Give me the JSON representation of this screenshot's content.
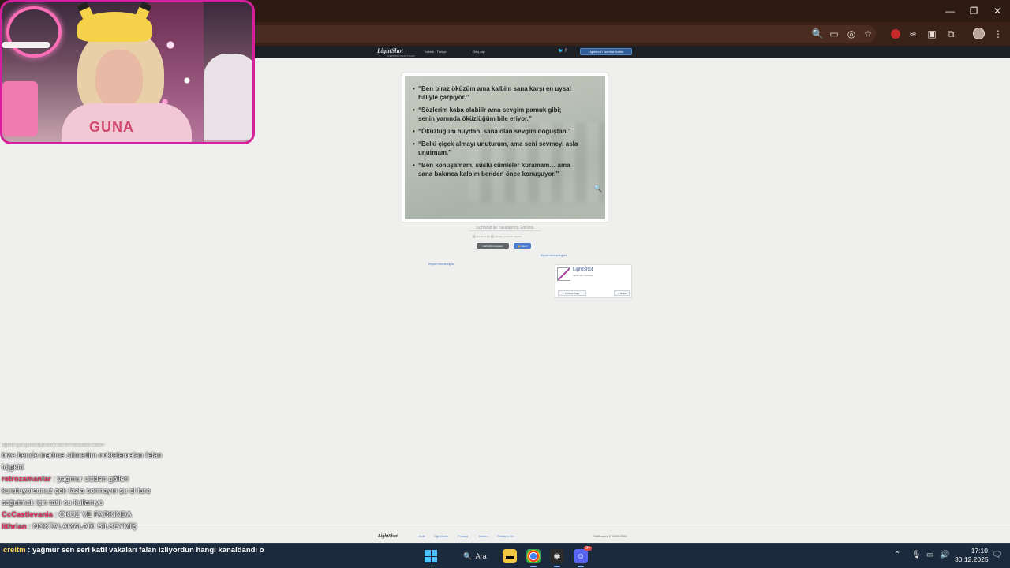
{
  "browser": {
    "window_controls": {
      "minimize": "—",
      "maximize": "❐",
      "close": "✕"
    }
  },
  "site": {
    "logo": "LightShot",
    "logo_sub": "SCREENSHOT SOFTWARE",
    "language": "Turkish - Türkçe",
    "login": "Giriş yap",
    "social": "🐦 f",
    "download_button": "Lightshot'ı ücretsiz indirin"
  },
  "screenshot": {
    "quotes": [
      "“Ben biraz öküzüm ama kalbim sana karşı en uysal haliyle çarpıyor.”",
      "“Sözlerim kaba olabilir ama sevgim pamuk gibi; senin yanında öküzlüğüm bile eriyor.”",
      "“Öküzlüğüm huydan, sana olan sevgim doğuştan.”",
      "“Belki çiçek almayı unuturum, ama seni sevmeyi asla unutmam.”",
      "“Ben konuşamam, süslü cümleler kuramam… ama sana bakınca kalbim benden önce konuşuyor.”"
    ],
    "caption": "Lightshot ile Yakalanmış Görüntü",
    "small_links": "🖼 Benzerini bul   🖼 Görsele yorumunu kaydet",
    "share_button": "Görüntüyü paylaşın",
    "like_button": "👍 Like 0",
    "report_left": "Report misleading ad",
    "report_right": "Report misleading ad"
  },
  "facebook_box": {
    "name": "LightShot",
    "subtitle": "Skillbrains Software",
    "follow": "Follow Page",
    "share": "Share"
  },
  "footer": {
    "logo": "LightShot",
    "links": [
      "İndir",
      "Öğreticiler",
      "Privacy",
      "Yardım",
      "Reklamı Ver"
    ],
    "copyright": "Skillbrains © 2009-2022"
  },
  "chat": {
    "faded": "oğmur gibi görünüyo biraz da sırf karşıdaki adam",
    "lines": [
      {
        "user": "",
        "text": "bize bende inadına silmedim noktalamaları falan fdjgkfd"
      },
      {
        "user": "retrozamanlar",
        "text": "yağmur cidden gölleri kurutuyorsunuz çok fazla sormayın şu ol fara soğutmak için tatlı su kullanıyo"
      },
      {
        "user": "CcCastlevania",
        "text": "ÖKÜZ VE FARKINDA"
      },
      {
        "user": "lithrian",
        "text": "NOKTALAMALARI SİLSEYMİŞ"
      }
    ],
    "taskbar_line_user": "creitm",
    "taskbar_line_text": "yağmur sen seri katil vakaları falan izliyordun hangi kanaldandı o"
  },
  "taskbar": {
    "search_label": "Ara",
    "discord_badge": "9+",
    "time": "17:10",
    "date": "30.12.2025"
  },
  "icons": [
    "zoom-icon",
    "cast-icon",
    "eye-off-icon",
    "star-icon",
    "extensions-icon",
    "profile-avatar",
    "menu-icon",
    "windows-start-icon",
    "search-icon",
    "file-explorer-icon",
    "chrome-icon",
    "discord-icon",
    "wifi-icon",
    "volume-icon",
    "mic-icon",
    "notification-icon"
  ],
  "colors": {
    "cam_border": "#d61f9b",
    "chrome_bg": "#2d1a12",
    "taskbar_bg": "#1c2a3d",
    "chat_user": "#e0305c"
  }
}
